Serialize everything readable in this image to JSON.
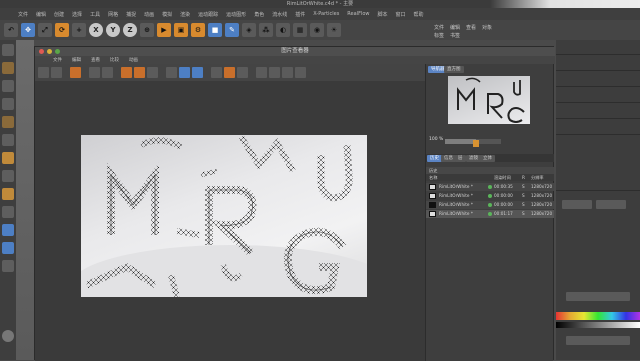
{
  "app": {
    "document_title": "RimLitOrWhite.c4d * - 主要",
    "menu": [
      "文件",
      "编辑",
      "创建",
      "选择",
      "工具",
      "网格",
      "捕捉",
      "动画",
      "模拟",
      "渲染",
      "运动跟踪",
      "运动图形",
      "角色",
      "流水线",
      "插件",
      "X-Particles",
      "RealFlow",
      "脚本",
      "窗口",
      "帮助"
    ],
    "toolbar_letters": [
      "X",
      "Y",
      "Z"
    ],
    "right_menu": [
      "文件",
      "编辑",
      "查看",
      "对象",
      "标签",
      "书签"
    ]
  },
  "viewer": {
    "title": "图片查看器",
    "menu": [
      "文件",
      "编辑",
      "查看",
      "比较",
      "动画"
    ],
    "tabs": {
      "navigator": "导航器",
      "histogram": "直方图"
    },
    "zoom": {
      "label": "100 %",
      "level": 0.55
    },
    "history_tabs": [
      "历史",
      "信息",
      "层",
      "滤镜",
      "立体"
    ],
    "history_header": "历史",
    "columns": {
      "name": "名称",
      "render_time": "渲染时间",
      "r": "R",
      "resolution": "分辨率"
    },
    "rows": [
      {
        "name": "RimLitOrWhite *",
        "time": "00:00:35",
        "r": "S",
        "res": "1280x720"
      },
      {
        "name": "RimLitOrWhite *",
        "time": "00:00:00",
        "r": "S",
        "res": "1280x720"
      },
      {
        "name": "RimLitOrWhite *",
        "time": "00:00:00",
        "r": "S",
        "res": "1280x720"
      },
      {
        "name": "RimLitOrWhite *",
        "time": "00:01:17",
        "r": "S",
        "res": "1280x720"
      }
    ]
  },
  "colors": {
    "accent": "#5b84c4",
    "toolbar_orange": "#d88a2e",
    "status_green": "#5ab55a"
  },
  "icons": [
    "undo-icon",
    "move-icon",
    "scale-icon",
    "rotate-icon",
    "axis-x-icon",
    "axis-y-icon",
    "axis-z-icon",
    "world-icon",
    "render-icon",
    "render-view-icon",
    "render-settings-icon",
    "cube-icon",
    "pen-icon",
    "subdivide-icon",
    "array-icon",
    "deformer-icon",
    "scene-icon",
    "camera-icon",
    "light-icon"
  ]
}
